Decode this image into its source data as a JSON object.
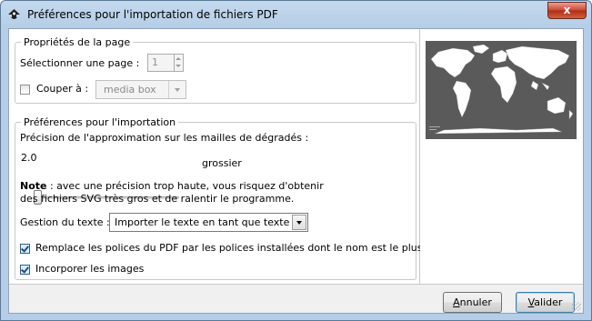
{
  "window": {
    "title": "Préférences pour l'importation de fichiers PDF",
    "close_label": "x",
    "icon": "inkscape-icon"
  },
  "page_props": {
    "legend": "Propriétés de la page",
    "select_page_label": "Sélectionner une page :",
    "page_value": "1",
    "crop_label": "Couper à :",
    "crop_checked": false,
    "crop_value": "media box"
  },
  "import_prefs": {
    "legend": "Préférences pour l'importation",
    "precision_label": "Précision de l'approximation sur les mailles de dégradés :",
    "precision_value": "2.0",
    "precision_level_text": "grossier",
    "precision_fraction": 0.0,
    "note_bold": "Note",
    "note_line1": " : avec une précision trop haute, vous risquez d'obtenir",
    "note_line2": "des fichiers SVG très gros et de ralentir le programme.",
    "text_handling_label": "Gestion du texte :",
    "text_handling_value": "Importer le texte en tant que texte",
    "replace_fonts_label": "Remplace les polices du PDF par les polices installées dont le nom est le plus proche",
    "replace_fonts_checked": true,
    "embed_images_label": "Incorporer les images",
    "embed_images_checked": true
  },
  "buttons": {
    "cancel_underlined": "A",
    "cancel_rest": "nnuler",
    "ok_underlined": "V",
    "ok_rest": "alider"
  },
  "colors": {
    "title_bg": "#b5cde6",
    "close_red": "#c9452e",
    "map_land": "#ffffff",
    "map_sea": "#5a5a5a"
  }
}
